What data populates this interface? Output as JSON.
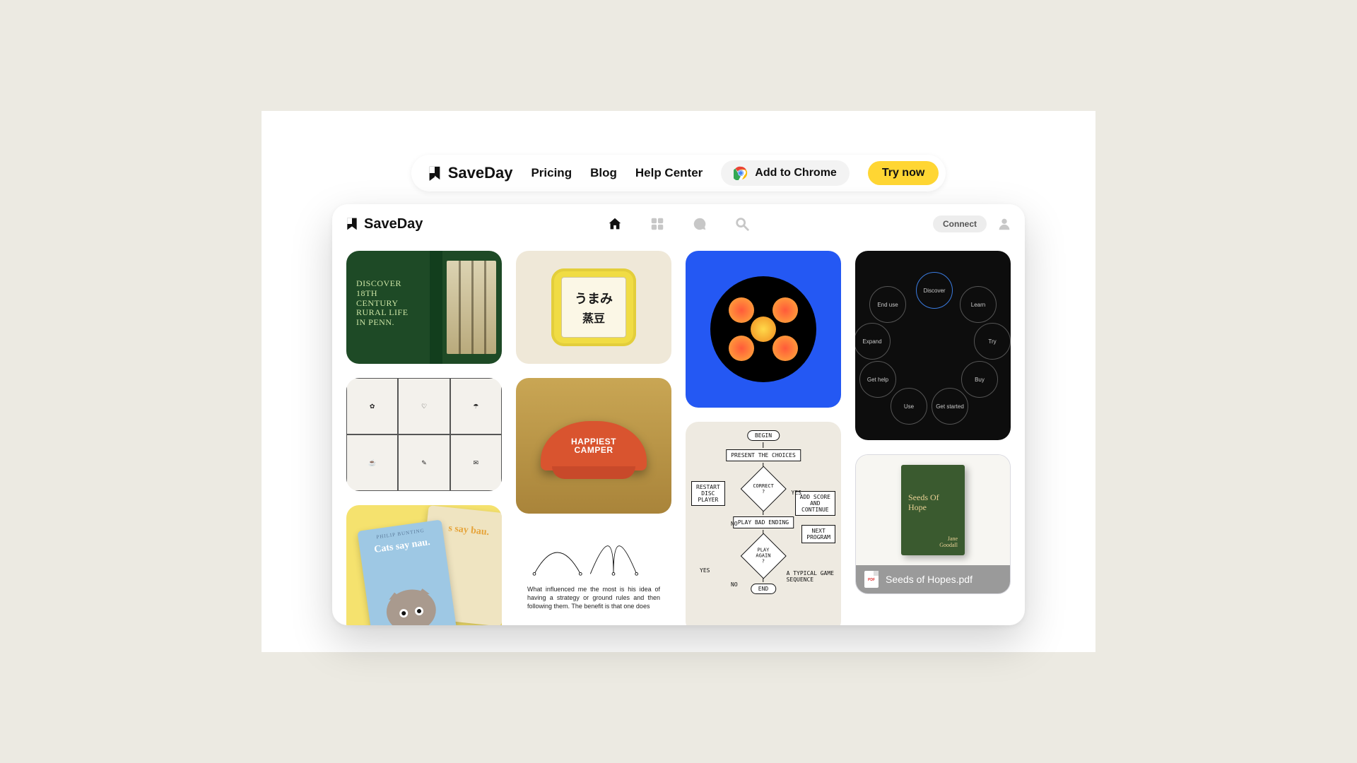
{
  "topbar": {
    "brand": "SaveDay",
    "nav": {
      "pricing": "Pricing",
      "blog": "Blog",
      "help": "Help Center"
    },
    "chrome_label": "Add to Chrome",
    "try_label": "Try now"
  },
  "app": {
    "brand": "SaveDay",
    "connect_label": "Connect"
  },
  "cards": {
    "rural": {
      "line1": "DISCOVER",
      "line2": "18TH",
      "line3": "CENTURY",
      "line4": "RURAL LIFE",
      "line5": "IN PENN."
    },
    "umami": {
      "top": "うまみ",
      "bottom": "蒸豆"
    },
    "cap": {
      "line1": "HAPPIEST",
      "line2": "CAMPER"
    },
    "bez_text": "What influenced me the most is his idea of having a strategy or ground rules and then following them. The benefit is that one does",
    "book": {
      "title1": "Cats say nau.",
      "title2": "s say bau."
    },
    "book_author": "PHILIP BUNTING",
    "flow": {
      "begin": "BEGIN",
      "present": "PRESENT THE CHOICES",
      "correct": "CORRECT\n?",
      "bad": "PLAY BAD ENDING",
      "again": "PLAY\nAGAIN\n?",
      "end": "END",
      "restart": "RESTART\nDISC\nPLAYER",
      "addscore": "ADD SCORE\nAND\nCONTINUE",
      "next": "NEXT\nPROGRAM",
      "caption": "A TYPICAL GAME\nSEQUENCE",
      "yes": "YES",
      "no": "NO"
    },
    "journey": [
      "Discover",
      "Learn",
      "Try",
      "Buy",
      "Get started",
      "Use",
      "Get help",
      "Expand",
      "End use"
    ],
    "seeds": {
      "title": "Seeds Of\nHope",
      "author": "Jane\nGoodall",
      "filename": "Seeds of Hopes.pdf"
    }
  },
  "colors": {
    "accent_blue": "#2458f3",
    "accent_yellow": "#ffd633"
  }
}
